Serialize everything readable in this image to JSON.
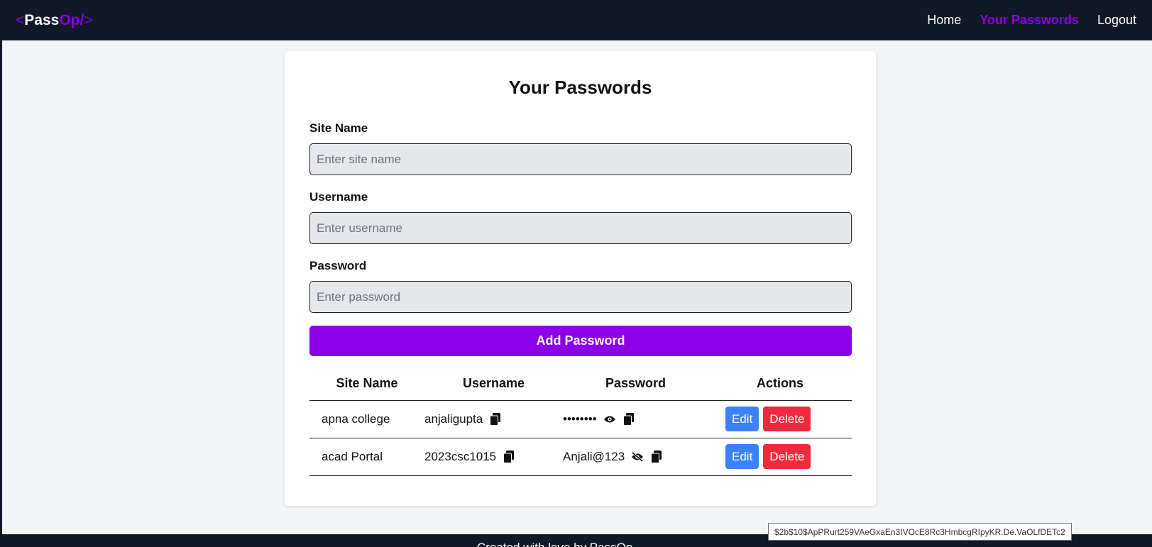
{
  "nav": {
    "logo_open": "<",
    "logo_pass": "Pass",
    "logo_op": "Op/",
    "logo_close": ">",
    "links": [
      {
        "label": "Home",
        "active": false
      },
      {
        "label": "Your Passwords",
        "active": true
      },
      {
        "label": "Logout",
        "active": false
      }
    ]
  },
  "form": {
    "title": "Your Passwords",
    "site_label": "Site Name",
    "site_placeholder": "Enter site name",
    "username_label": "Username",
    "username_placeholder": "Enter username",
    "password_label": "Password",
    "password_placeholder": "Enter password",
    "submit_label": "Add Password"
  },
  "table": {
    "headers": [
      "Site Name",
      "Username",
      "Password",
      "Actions"
    ],
    "rows": [
      {
        "site": "apna college",
        "username": "anjaligupta",
        "password": "••••••••",
        "visibility_icon": "eye-icon",
        "edit": "Edit",
        "delete": "Delete"
      },
      {
        "site": "acad Portal",
        "username": "2023csc1015",
        "password": "Anjali@123",
        "visibility_icon": "eye-slash-icon",
        "edit": "Edit",
        "delete": "Delete"
      }
    ]
  },
  "tooltip": "$2b$10$ApPRurt259VAeGxaEn3IVOcE8Rc3HmbcgRIpyKR.De.VaOLfDETc2",
  "footer": {
    "text": "Created with love by PassOp"
  },
  "colors": {
    "brand": "#8b00e6",
    "navbar": "#111827",
    "edit": "#3b82f6",
    "delete": "#f0293e"
  }
}
